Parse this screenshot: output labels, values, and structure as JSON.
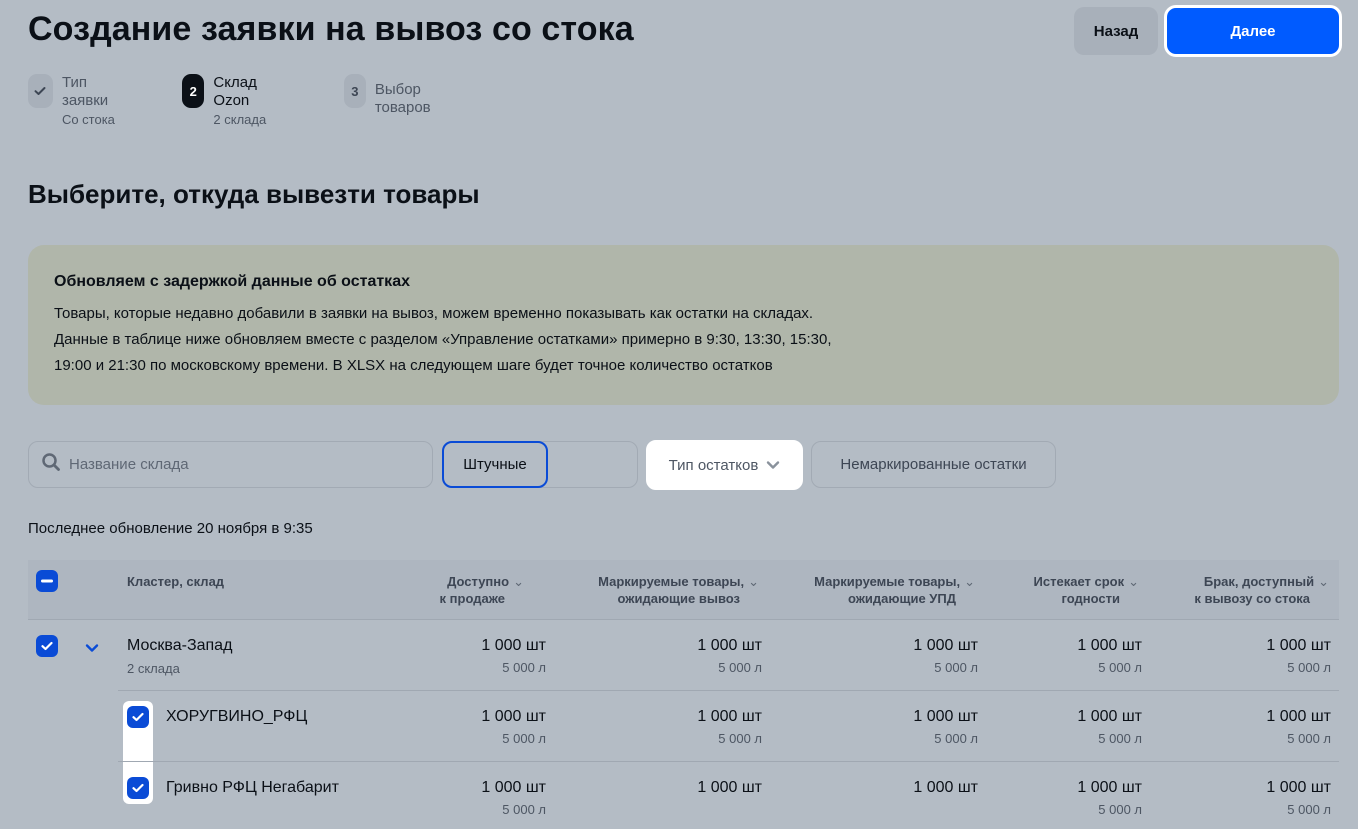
{
  "header": {
    "title": "Создание заявки на вывоз со стока",
    "back_label": "Назад",
    "next_label": "Далее"
  },
  "stepper": [
    {
      "badge": "✓",
      "title": "Тип заявки",
      "subtitle": "Со стока",
      "state": "done"
    },
    {
      "badge": "2",
      "title": "Склад Ozon",
      "subtitle": "2 склада",
      "state": "active"
    },
    {
      "badge": "3",
      "title": "Выбор товаров",
      "subtitle": "",
      "state": "todo"
    }
  ],
  "section_title": "Выберите, откуда вывезти товары",
  "notice": {
    "title": "Обновляем с задержкой данные об остатках",
    "lines": [
      "Товары, которые недавно добавили в заявки на вывоз, можем временно показывать как остатки на складах.",
      "Данные в таблице ниже обновляем вместе с разделом «Управление остатками» примерно в 9:30, 13:30, 15:30,",
      "19:00 и 21:30 по московскому времени. В XLSX на следующем шаге будет точное количество остатков"
    ]
  },
  "filters": {
    "search_placeholder": "Название склада",
    "segment_active": "Штучные",
    "remains_type": "Тип остатков",
    "unmarked_chip": "Немаркированные остатки"
  },
  "last_update": "Последнее обновление 20 ноября в 9:35",
  "table": {
    "headers": {
      "cluster": "Кластер, склад",
      "available_1": "Доступно",
      "available_2": "к продаже",
      "marked_out_1": "Маркируемые товары,",
      "marked_out_2": "ожидающие вывоз",
      "marked_upd_1": "Маркируемые товары,",
      "marked_upd_2": "ожидающие УПД",
      "expiring_1": "Истекает срок",
      "expiring_2": "годности",
      "defect_1": "Брак, доступный",
      "defect_2": "к вывозу со стока"
    },
    "rows": [
      {
        "name": "Москва-Запад",
        "subtitle": "2 склада",
        "c1q": "1 000 шт",
        "c1v": "5 000 л",
        "c2q": "1 000 шт",
        "c2v": "5 000 л",
        "c3q": "1 000 шт",
        "c3v": "5 000 л",
        "c4q": "1 000 шт",
        "c4v": "5 000 л",
        "c5q": "1 000 шт",
        "c5v": "5 000 л"
      },
      {
        "name": "ХОРУГВИНО_РФЦ",
        "c1q": "1 000 шт",
        "c1v": "5 000 л",
        "c2q": "1 000 шт",
        "c2v": "5 000 л",
        "c3q": "1 000 шт",
        "c3v": "5 000 л",
        "c4q": "1 000 шт",
        "c4v": "5 000 л",
        "c5q": "1 000 шт",
        "c5v": "5 000 л"
      },
      {
        "name": "Гривно РФЦ Негабарит",
        "c1q": "1 000 шт",
        "c1v": "5 000 л",
        "c2q": "1 000 шт",
        "c3q": "1 000 шт",
        "c4q": "1 000 шт",
        "c4v": "5 000 л",
        "c5q": "1 000 шт",
        "c5v": "5 000 л"
      }
    ]
  }
}
